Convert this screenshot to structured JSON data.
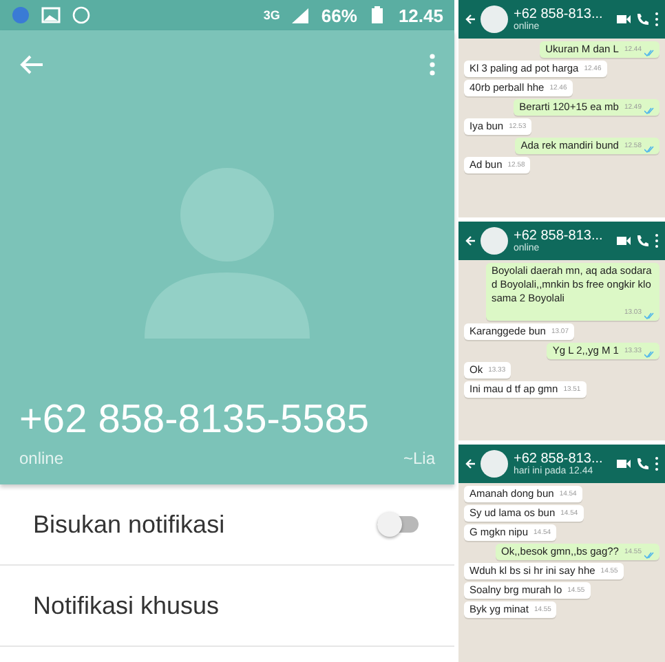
{
  "status_bar": {
    "network": "3G",
    "battery": "66%",
    "time": "12.45"
  },
  "profile": {
    "name": "+62 858-8135-5585",
    "status": "online",
    "push_name": "~Lia"
  },
  "settings": [
    {
      "kind": "toggle",
      "label": "Bisukan notifikasi",
      "on": false
    },
    {
      "kind": "link",
      "label": "Notifikasi khusus"
    }
  ],
  "chats": [
    {
      "title": "+62 858-813...",
      "subtitle": "online",
      "messages": [
        {
          "text": "Ukuran M dan L",
          "time": "12.44",
          "outgoing": true
        },
        {
          "text": "Kl 3 paling ad pot harga",
          "time": "12.46",
          "outgoing": false
        },
        {
          "text": "40rb perball hhe",
          "time": "12.46",
          "outgoing": false
        },
        {
          "text": "Berarti 120+15 ea mb",
          "time": "12.49",
          "outgoing": true
        },
        {
          "text": "Iya bun",
          "time": "12.53",
          "outgoing": false
        },
        {
          "text": "Ada rek mandiri bund",
          "time": "12.58",
          "outgoing": true
        },
        {
          "text": "Ad bun",
          "time": "12.58",
          "outgoing": false
        }
      ]
    },
    {
      "title": "+62 858-813...",
      "subtitle": "online",
      "messages": [
        {
          "text": "Boyolali daerah mn, aq ada sodara d Boyolali,,mnkin bs free ongkir klo sama 2 Boyolali",
          "time": "13.03",
          "outgoing": true
        },
        {
          "text": "Karanggede bun",
          "time": "13.07",
          "outgoing": false
        },
        {
          "text": "Yg L 2,,yg M 1",
          "time": "13.33",
          "outgoing": true
        },
        {
          "text": "Ok",
          "time": "13.33",
          "outgoing": false
        },
        {
          "text": "Ini mau d tf ap gmn",
          "time": "13.51",
          "outgoing": false
        }
      ]
    },
    {
      "title": "+62 858-813...",
      "subtitle": "hari ini pada 12.44",
      "messages": [
        {
          "text": "Amanah dong bun",
          "time": "14.54",
          "outgoing": false
        },
        {
          "text": "Sy ud lama os bun",
          "time": "14.54",
          "outgoing": false
        },
        {
          "text": "G mgkn nipu",
          "time": "14.54",
          "outgoing": false
        },
        {
          "text": "Ok,,besok gmn,,bs gag??",
          "time": "14.55",
          "outgoing": true
        },
        {
          "text": "Wduh kl bs si hr ini say hhe",
          "time": "14.55",
          "outgoing": false
        },
        {
          "text": "Soalny brg murah lo",
          "time": "14.55",
          "outgoing": false
        },
        {
          "text": "Byk yg minat",
          "time": "14.55",
          "outgoing": false
        }
      ]
    }
  ]
}
